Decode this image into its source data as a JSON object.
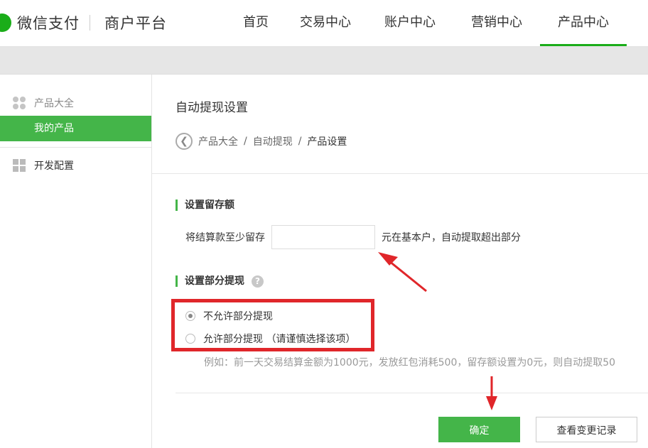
{
  "header": {
    "logo_text": "微信支付",
    "platform_text": "商户平台",
    "nav": [
      "首页",
      "交易中心",
      "账户中心",
      "营销中心",
      "产品中心"
    ],
    "active_nav": "产品中心"
  },
  "sidebar": {
    "group_label": "产品大全",
    "active_item": "我的产品",
    "dev_item": "开发配置"
  },
  "main": {
    "title": "自动提现设置",
    "breadcrumb": [
      "产品大全",
      "自动提现",
      "产品设置"
    ],
    "section1_title": "设置留存额",
    "reserve_prefix": "将结算款至少留存",
    "reserve_value": "",
    "reserve_suffix": "元在基本户，自动提取超出部分",
    "section2_title": "设置部分提现",
    "help_icon": "?",
    "radio_disallow": "不允许部分提现",
    "radio_allow": "允许部分提现 （请谨慎选择该项）",
    "selected_option": "不允许部分提现",
    "example_text": "例如：前一天交易结算金额为1000元，发放红包消耗500，留存额设置为0元，则自动提取50",
    "confirm_label": "确定",
    "history_label": "查看变更记录"
  },
  "colors": {
    "brand_green": "#44b549",
    "annotation_red": "#e0262a"
  },
  "icons": [
    "back-arrow-icon",
    "help-icon",
    "product-grid-icon",
    "dev-config-icon"
  ]
}
